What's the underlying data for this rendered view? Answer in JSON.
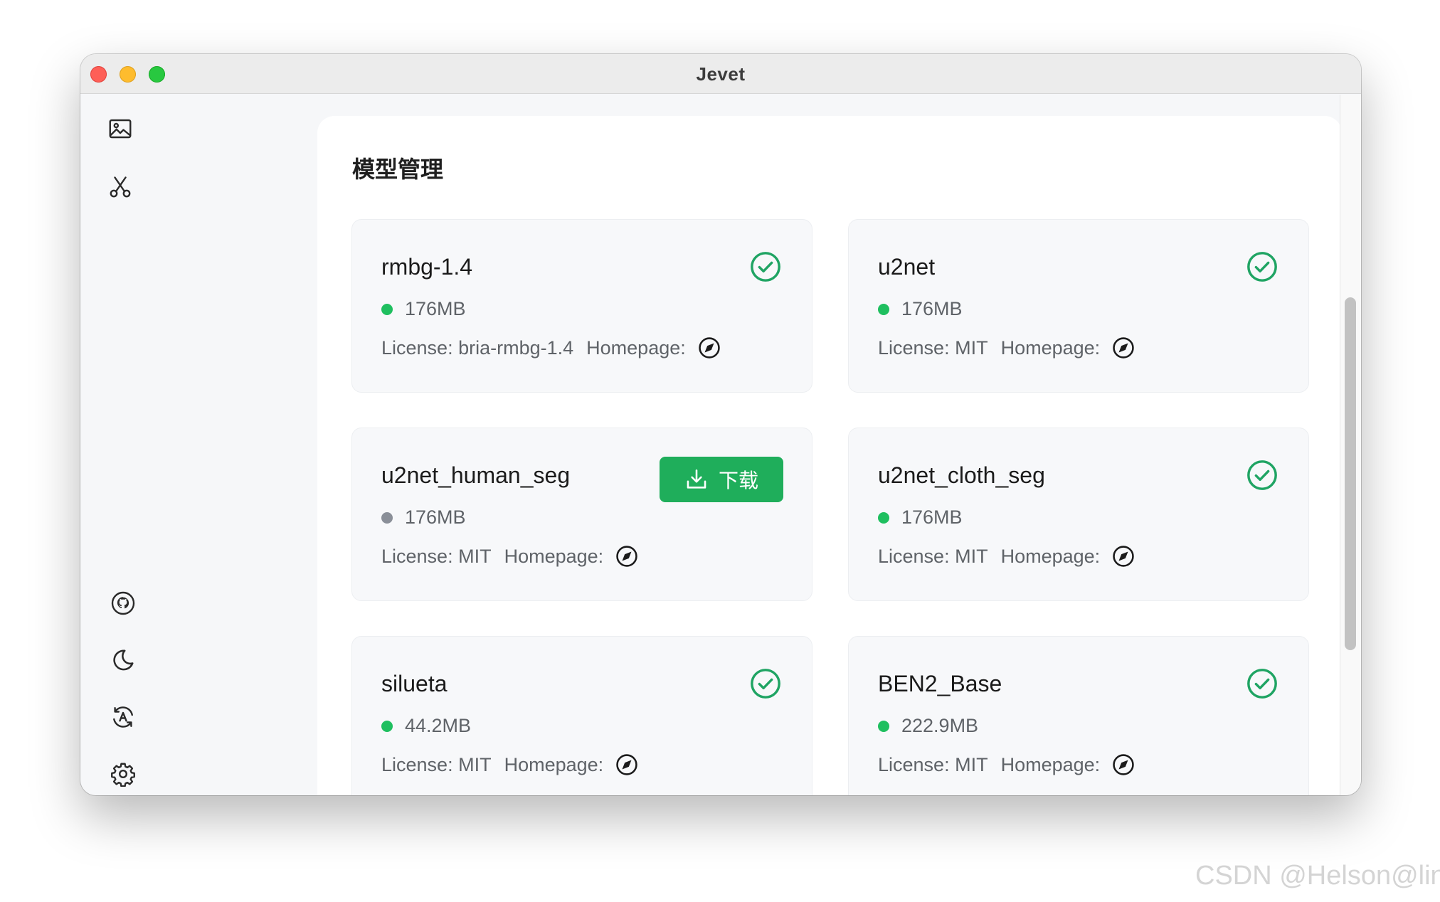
{
  "window": {
    "title": "Jevet"
  },
  "sidebar": {
    "top_items": [
      {
        "icon": "image-icon"
      },
      {
        "icon": "scissors-icon"
      }
    ],
    "bottom_items": [
      {
        "icon": "github-icon"
      },
      {
        "icon": "moon-icon"
      },
      {
        "icon": "language-icon"
      },
      {
        "icon": "gear-icon"
      }
    ]
  },
  "panel": {
    "title": "模型管理"
  },
  "labels": {
    "license": "License:",
    "homepage": "Homepage:",
    "download": "下载"
  },
  "models": [
    {
      "name": "rmbg-1.4",
      "size": "176MB",
      "license": "bria-rmbg-1.4",
      "downloaded": true
    },
    {
      "name": "u2net",
      "size": "176MB",
      "license": "MIT",
      "downloaded": true
    },
    {
      "name": "u2net_human_seg",
      "size": "176MB",
      "license": "MIT",
      "downloaded": false
    },
    {
      "name": "u2net_cloth_seg",
      "size": "176MB",
      "license": "MIT",
      "downloaded": true
    },
    {
      "name": "silueta",
      "size": "44.2MB",
      "license": "MIT",
      "downloaded": true
    },
    {
      "name": "BEN2_Base",
      "size": "222.9MB",
      "license": "MIT",
      "downloaded": true
    }
  ],
  "colors": {
    "accent": "#1fae5b",
    "status_ok": "#1fbf5f",
    "status_off": "#8a8f98",
    "check": "#1fa463"
  },
  "watermark": "CSDN @Helson@lin"
}
